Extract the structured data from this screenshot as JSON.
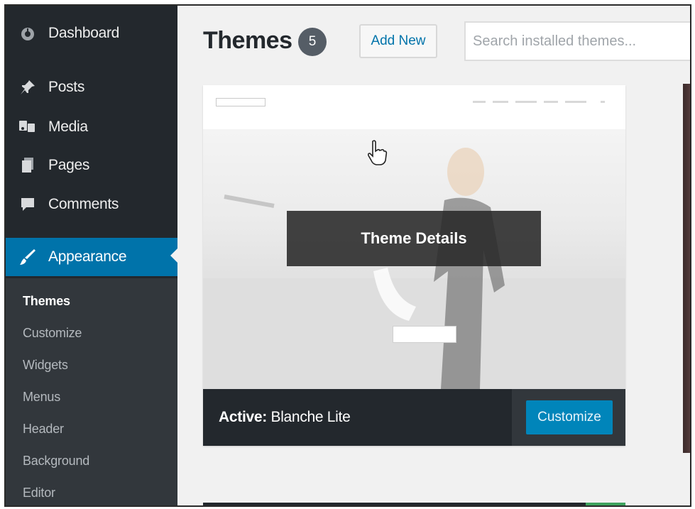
{
  "sidebar": {
    "items": [
      {
        "label": "Dashboard",
        "icon": "dashboard-icon"
      },
      {
        "label": "Posts",
        "icon": "pin-icon"
      },
      {
        "label": "Media",
        "icon": "media-icon"
      },
      {
        "label": "Pages",
        "icon": "pages-icon"
      },
      {
        "label": "Comments",
        "icon": "comment-icon"
      },
      {
        "label": "Appearance",
        "icon": "brush-icon",
        "active": true
      }
    ],
    "submenu": [
      "Themes",
      "Customize",
      "Widgets",
      "Menus",
      "Header",
      "Background",
      "Editor"
    ],
    "current_submenu": "Themes"
  },
  "header": {
    "title": "Themes",
    "count": "5",
    "add_new_label": "Add New",
    "search_placeholder": "Search installed themes..."
  },
  "theme_card": {
    "overlay_label": "Theme Details",
    "active_prefix": "Active:",
    "active_name": "Blanche Lite",
    "customize_label": "Customize"
  },
  "colors": {
    "sidebar_bg": "#23282d",
    "accent": "#0073aa",
    "customize_button": "#0085ba"
  }
}
